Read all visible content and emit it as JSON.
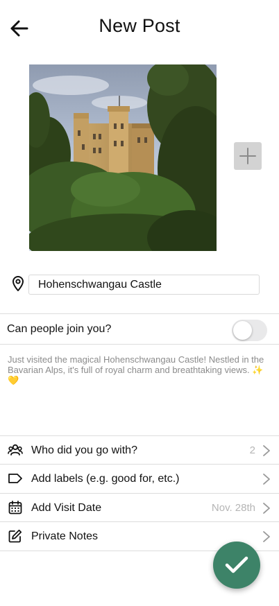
{
  "header": {
    "title": "New Post",
    "back_icon": "arrow-left-icon"
  },
  "photo": {
    "subject": "castle-photo",
    "add_icon": "plus-icon"
  },
  "location": {
    "icon": "map-pin-icon",
    "value": "Hohenschwangau Castle"
  },
  "join": {
    "label": "Can people join you?",
    "enabled": false
  },
  "description": {
    "text": "Just visited the magical Hohenschwangau Castle! Nestled in the Bavarian Alps, it's full of royal charm and breathtaking views. ✨💛"
  },
  "rows": [
    {
      "icon": "people-icon",
      "label": "Who did you go with?",
      "value": "2"
    },
    {
      "icon": "tag-icon",
      "label": "Add labels (e.g. good for, etc.)",
      "value": ""
    },
    {
      "icon": "calendar-icon",
      "label": "Add Visit Date",
      "value": "Nov. 28th"
    },
    {
      "icon": "edit-icon",
      "label": "Private Notes",
      "value": ""
    }
  ],
  "fab": {
    "icon": "checkmark-icon",
    "color": "#3d8368"
  }
}
